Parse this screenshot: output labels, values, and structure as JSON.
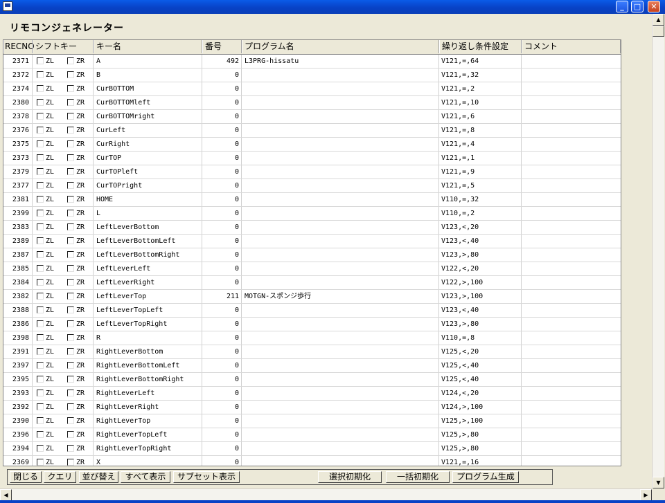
{
  "window": {
    "minimize_glyph": "_",
    "maximize_glyph": "□",
    "close_glyph": "✕"
  },
  "heading": "リモコンジェネレーター",
  "columns": {
    "recno": "RECNO",
    "shift": "シフトキー",
    "key": "キー名",
    "num": "番号",
    "prog": "プログラム名",
    "repeat": "繰り返し条件設定",
    "comment": "コメント"
  },
  "checkbox_labels": {
    "zl": "ZL",
    "zr": "ZR"
  },
  "rows": [
    {
      "rec": "2371",
      "key": "A",
      "num": "492",
      "prog": "L3PRG-hissatu",
      "rep": "V121,=,64"
    },
    {
      "rec": "2372",
      "key": "B",
      "num": "0",
      "prog": "",
      "rep": "V121,=,32"
    },
    {
      "rec": "2374",
      "key": "CurBOTTOM",
      "num": "0",
      "prog": "",
      "rep": "V121,=,2"
    },
    {
      "rec": "2380",
      "key": "CurBOTTOMleft",
      "num": "0",
      "prog": "",
      "rep": "V121,=,10"
    },
    {
      "rec": "2378",
      "key": "CurBOTTOMright",
      "num": "0",
      "prog": "",
      "rep": "V121,=,6"
    },
    {
      "rec": "2376",
      "key": "CurLeft",
      "num": "0",
      "prog": "",
      "rep": "V121,=,8"
    },
    {
      "rec": "2375",
      "key": "CurRight",
      "num": "0",
      "prog": "",
      "rep": "V121,=,4"
    },
    {
      "rec": "2373",
      "key": "CurTOP",
      "num": "0",
      "prog": "",
      "rep": "V121,=,1"
    },
    {
      "rec": "2379",
      "key": "CurTOPleft",
      "num": "0",
      "prog": "",
      "rep": "V121,=,9"
    },
    {
      "rec": "2377",
      "key": "CurTOPright",
      "num": "0",
      "prog": "",
      "rep": "V121,=,5"
    },
    {
      "rec": "2381",
      "key": "HOME",
      "num": "0",
      "prog": "",
      "rep": "V110,=,32"
    },
    {
      "rec": "2399",
      "key": "L",
      "num": "0",
      "prog": "",
      "rep": "V110,=,2"
    },
    {
      "rec": "2383",
      "key": "LeftLeverBottom",
      "num": "0",
      "prog": "",
      "rep": "V123,<,20"
    },
    {
      "rec": "2389",
      "key": "LeftLeverBottomLeft",
      "num": "0",
      "prog": "",
      "rep": "V123,<,40"
    },
    {
      "rec": "2387",
      "key": "LeftLeverBottomRight",
      "num": "0",
      "prog": "",
      "rep": "V123,>,80"
    },
    {
      "rec": "2385",
      "key": "LeftLeverLeft",
      "num": "0",
      "prog": "",
      "rep": "V122,<,20"
    },
    {
      "rec": "2384",
      "key": "LeftLeverRight",
      "num": "0",
      "prog": "",
      "rep": "V122,>,100"
    },
    {
      "rec": "2382",
      "key": "LeftLeverTop",
      "num": "211",
      "prog": "MOTGN-スポンジ歩行",
      "rep": "V123,>,100"
    },
    {
      "rec": "2388",
      "key": "LeftLeverTopLeft",
      "num": "0",
      "prog": "",
      "rep": "V123,<,40"
    },
    {
      "rec": "2386",
      "key": "LeftLeverTopRight",
      "num": "0",
      "prog": "",
      "rep": "V123,>,80"
    },
    {
      "rec": "2398",
      "key": "R",
      "num": "0",
      "prog": "",
      "rep": "V110,=,8"
    },
    {
      "rec": "2391",
      "key": "RightLeverBottom",
      "num": "0",
      "prog": "",
      "rep": "V125,<,20"
    },
    {
      "rec": "2397",
      "key": "RightLeverBottomLeft",
      "num": "0",
      "prog": "",
      "rep": "V125,<,40"
    },
    {
      "rec": "2395",
      "key": "RightLeverBottomRight",
      "num": "0",
      "prog": "",
      "rep": "V125,<,40"
    },
    {
      "rec": "2393",
      "key": "RightLeverLeft",
      "num": "0",
      "prog": "",
      "rep": "V124,<,20"
    },
    {
      "rec": "2392",
      "key": "RightLeverRight",
      "num": "0",
      "prog": "",
      "rep": "V124,>,100"
    },
    {
      "rec": "2390",
      "key": "RightLeverTop",
      "num": "0",
      "prog": "",
      "rep": "V125,>,100"
    },
    {
      "rec": "2396",
      "key": "RightLeverTopLeft",
      "num": "0",
      "prog": "",
      "rep": "V125,>,80"
    },
    {
      "rec": "2394",
      "key": "RightLeverTopRight",
      "num": "0",
      "prog": "",
      "rep": "V125,>,80"
    },
    {
      "rec": "2369",
      "key": "X",
      "num": "0",
      "prog": "",
      "rep": "V121,=,16"
    }
  ],
  "toolbar": {
    "close": "閉じる",
    "query": "クエリ",
    "sort": "並び替え",
    "show_all": "すべて表示",
    "subset": "サブセット表示",
    "reset_selected": "選択初期化",
    "reset_all": "一括初期化",
    "generate": "プログラム生成"
  },
  "scroll": {
    "up_glyph": "▲",
    "down_glyph": "▼",
    "left_glyph": "◀",
    "right_glyph": "▶"
  }
}
